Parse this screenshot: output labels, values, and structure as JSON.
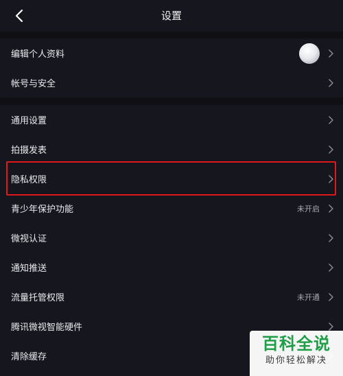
{
  "header": {
    "title": "设置",
    "back_icon": "chevron-left-icon"
  },
  "groups": [
    {
      "items": [
        {
          "label": "编辑个人资料",
          "avatar": true
        },
        {
          "label": "帐号与安全"
        }
      ]
    },
    {
      "items": [
        {
          "label": "通用设置"
        },
        {
          "label": "拍摄发表"
        },
        {
          "label": "隐私权限",
          "highlighted": true
        },
        {
          "label": "青少年保护功能",
          "value": "未开启"
        },
        {
          "label": "微视认证"
        },
        {
          "label": "通知推送"
        },
        {
          "label": "流量托管权限",
          "value": "未开通"
        },
        {
          "label": "腾讯微视智能硬件"
        },
        {
          "label": "清除缓存"
        }
      ]
    }
  ],
  "watermark": {
    "title": "百科全说",
    "subtitle": "助你轻松解决"
  },
  "colors": {
    "background": "#0f0f14",
    "panel": "#16171e",
    "highlight": "#e01a1a",
    "watermark_green": "#1f9e47"
  }
}
